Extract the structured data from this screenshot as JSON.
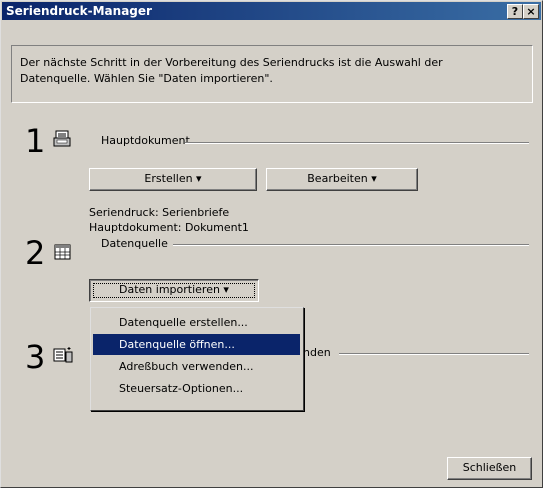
{
  "window": {
    "title": "Seriendruck-Manager",
    "help_button": "?",
    "close_button": "×"
  },
  "info": {
    "line1": "Der nächste Schritt in der Vorbereitung des Seriendrucks ist die Auswahl der",
    "line2": "Datenquelle. Wählen Sie \"Daten importieren\"."
  },
  "step1": {
    "number": "1",
    "label": "Hauptdokument",
    "create_button": "Erstellen ▾",
    "edit_button": "Bearbeiten ▾",
    "status_line1": "Seriendruck: Serienbriefe",
    "status_line2": "Hauptdokument: Dokument1"
  },
  "step2": {
    "number": "2",
    "label": "Datenquelle",
    "import_button": "Daten importieren ▾"
  },
  "step3": {
    "number": "3",
    "label_partial": "nden"
  },
  "menu": {
    "items": [
      {
        "label": "Datenquelle erstellen..."
      },
      {
        "label": "Datenquelle öffnen..."
      },
      {
        "label": "Adreßbuch verwenden..."
      },
      {
        "label": "Steuersatz-Optionen..."
      }
    ]
  },
  "footer": {
    "close_button": "Schließen"
  },
  "colors": {
    "title_bar": "#0a246a",
    "dialog_bg": "#d4d0c8",
    "highlight": "#0a246a"
  }
}
